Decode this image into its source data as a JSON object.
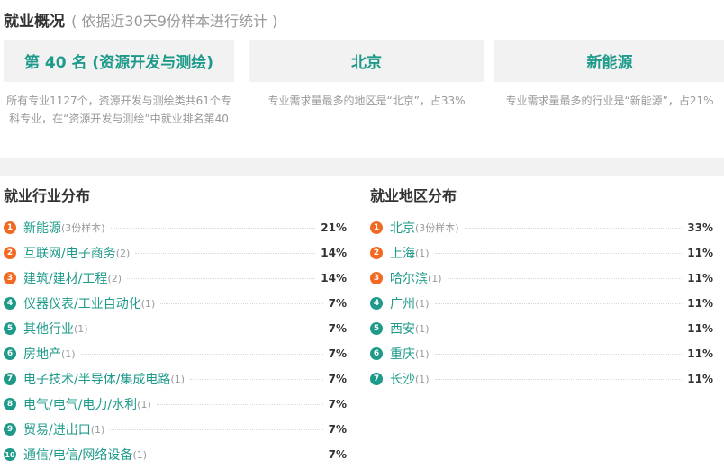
{
  "overview": {
    "title": "就业概况",
    "subtitle": "( 依据近30天9份样本进行统计 )"
  },
  "cards": [
    {
      "value": "第 40 名 (资源开发与测绘)",
      "desc": "所有专业1127个，资源开发与测绘类共61个专科专业，在“资源开发与测绘”中就业排名第40"
    },
    {
      "value": "北京",
      "desc": "专业需求量最多的地区是“北京”，占33%"
    },
    {
      "value": "新能源",
      "desc": "专业需求量最多的行业是“新能源”，占21%"
    }
  ],
  "industry": {
    "title": "就业行业分布",
    "items": [
      {
        "rank": "1",
        "name": "新能源",
        "count": "(3份样本)",
        "pct": "21%"
      },
      {
        "rank": "2",
        "name": "互联网/电子商务",
        "count": "(2)",
        "pct": "14%"
      },
      {
        "rank": "3",
        "name": "建筑/建材/工程",
        "count": "(2)",
        "pct": "14%"
      },
      {
        "rank": "4",
        "name": "仪器仪表/工业自动化",
        "count": "(1)",
        "pct": "7%"
      },
      {
        "rank": "5",
        "name": "其他行业",
        "count": "(1)",
        "pct": "7%"
      },
      {
        "rank": "6",
        "name": "房地产",
        "count": "(1)",
        "pct": "7%"
      },
      {
        "rank": "7",
        "name": "电子技术/半导体/集成电路",
        "count": "(1)",
        "pct": "7%"
      },
      {
        "rank": "8",
        "name": "电气/电气/电力/水利",
        "count": "(1)",
        "pct": "7%"
      },
      {
        "rank": "9",
        "name": "贸易/进出口",
        "count": "(1)",
        "pct": "7%"
      },
      {
        "rank": "10",
        "name": "通信/电信/网络设备",
        "count": "(1)",
        "pct": "7%"
      }
    ]
  },
  "region": {
    "title": "就业地区分布",
    "items": [
      {
        "rank": "1",
        "name": "北京",
        "count": "(3份样本)",
        "pct": "33%"
      },
      {
        "rank": "2",
        "name": "上海",
        "count": "(1)",
        "pct": "11%"
      },
      {
        "rank": "3",
        "name": "哈尔滨",
        "count": "(1)",
        "pct": "11%"
      },
      {
        "rank": "4",
        "name": "广州",
        "count": "(1)",
        "pct": "11%"
      },
      {
        "rank": "5",
        "name": "西安",
        "count": "(1)",
        "pct": "11%"
      },
      {
        "rank": "6",
        "name": "重庆",
        "count": "(1)",
        "pct": "11%"
      },
      {
        "rank": "7",
        "name": "长沙",
        "count": "(1)",
        "pct": "11%"
      }
    ]
  },
  "colors": {
    "accent": "#1e9a8a",
    "badge_top": "#f26a21",
    "badge_rest": "#1e9a8a"
  }
}
